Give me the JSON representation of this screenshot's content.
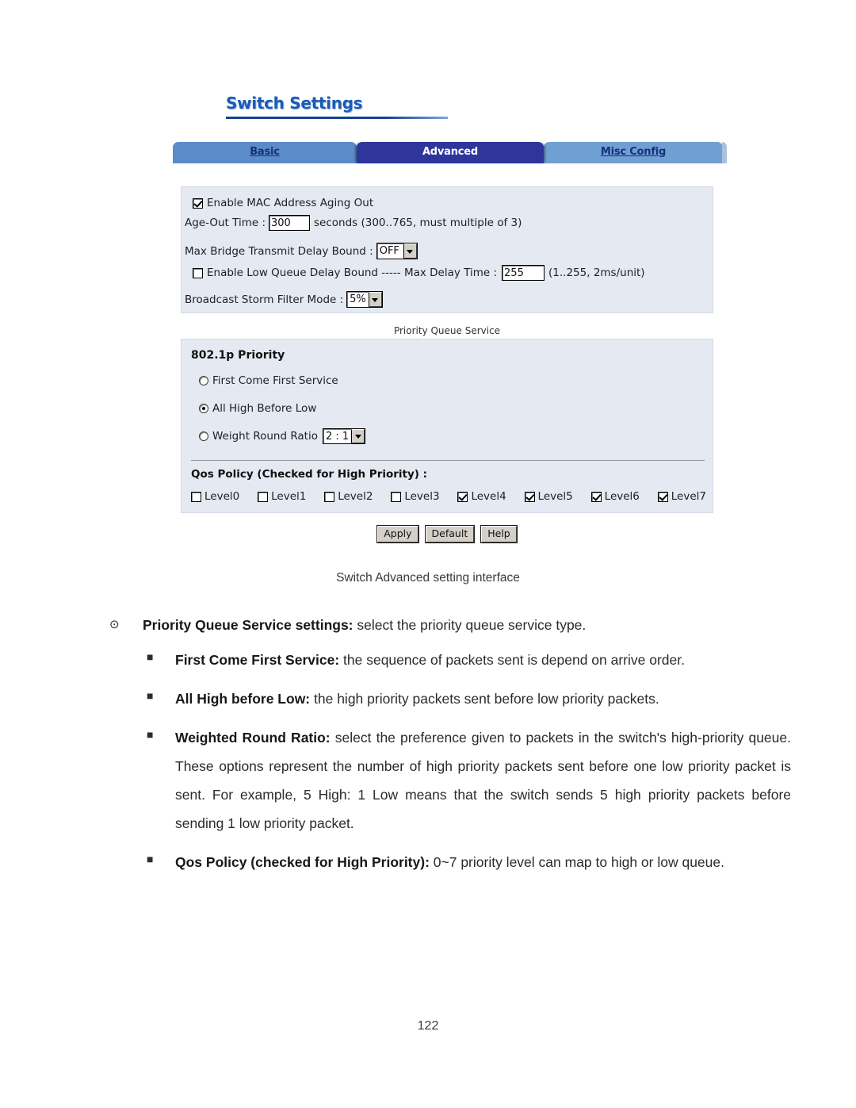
{
  "figure": {
    "title": "Switch Settings",
    "tabs": [
      {
        "label": "Basic",
        "active": false
      },
      {
        "label": "Advanced",
        "active": true
      },
      {
        "label": "Misc Config",
        "active": false
      }
    ],
    "main_panel": {
      "aging_checkbox_label": "Enable MAC Address Aging Out",
      "aging_checked": true,
      "age_out_label": "Age-Out Time :",
      "age_out_value": "300",
      "age_out_hint": "seconds (300..765, must multiple of 3)",
      "max_bridge_label": "Max Bridge Transmit Delay Bound :",
      "max_bridge_value": "OFF",
      "low_queue_checkbox_label": "Enable Low Queue Delay Bound ----- Max Delay Time :",
      "low_queue_checked": false,
      "max_delay_value": "255",
      "max_delay_hint": "(1..255, 2ms/unit)",
      "broadcast_label": "Broadcast Storm Filter Mode :",
      "broadcast_value": "5%"
    },
    "pqs_caption": "Priority Queue Service",
    "pqs_panel": {
      "header": "802.1p Priority",
      "options": [
        {
          "label": "First Come First Service",
          "selected": false
        },
        {
          "label": "All High Before Low",
          "selected": true
        },
        {
          "label": "Weight Round Ratio",
          "selected": false,
          "ratio_value": "2 : 1"
        }
      ],
      "qos_header": "Qos Policy (Checked for High Priority) :",
      "levels": [
        {
          "label": "Level0",
          "checked": false
        },
        {
          "label": "Level1",
          "checked": false
        },
        {
          "label": "Level2",
          "checked": false
        },
        {
          "label": "Level3",
          "checked": false
        },
        {
          "label": "Level4",
          "checked": true
        },
        {
          "label": "Level5",
          "checked": true
        },
        {
          "label": "Level6",
          "checked": true
        },
        {
          "label": "Level7",
          "checked": true
        }
      ]
    },
    "buttons": [
      {
        "label": "Apply"
      },
      {
        "label": "Default"
      },
      {
        "label": "Help"
      }
    ]
  },
  "caption": "Switch Advanced setting interface",
  "bullets": {
    "main_marker": "⊙",
    "sub_marker": "■",
    "main": {
      "bold": "Priority Queue Service settings:",
      "rest": " select the priority queue service type."
    },
    "items": [
      {
        "bold": "First Come First Service:",
        "rest": " the sequence of packets sent is depend on arrive order."
      },
      {
        "bold": "All High before Low:",
        "rest": " the high priority packets sent before low priority packets."
      },
      {
        "bold": "Weighted Round Ratio:",
        "rest": " select the preference given to packets in the switch's high-priority queue. These options represent the number of high priority packets sent before one low priority packet is sent. For example, 5 High: 1 Low means that the switch sends 5 high priority packets before sending 1 low priority packet."
      },
      {
        "bold": "Qos Policy (checked for High Priority):",
        "rest": " 0~7 priority level can map to high or low queue."
      }
    ]
  },
  "page_number": "122",
  "colors": {
    "title_blue": "#1a5bb8",
    "tab_active": "#2e369c",
    "tab_inactive_left": "#5b8bc8",
    "tab_inactive_right": "#6f9fd3",
    "panel_bg": "#e4e9f2",
    "button_face": "#d4d0c8"
  }
}
